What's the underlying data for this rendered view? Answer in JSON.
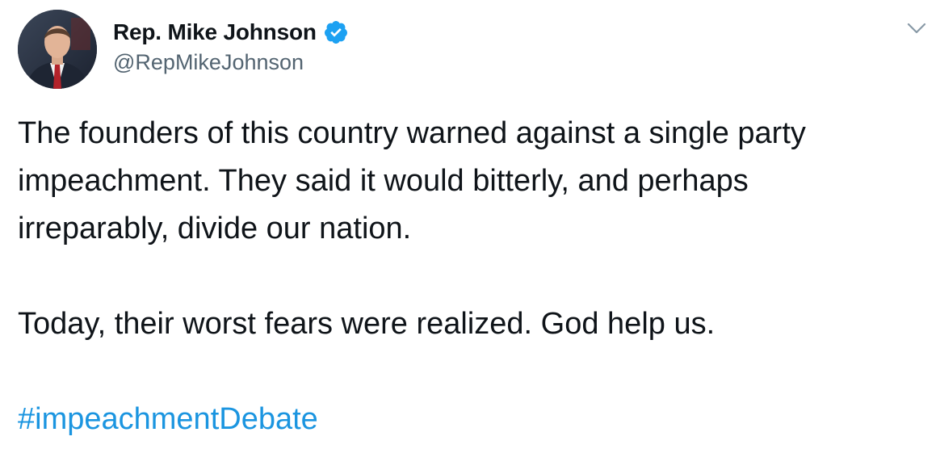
{
  "author": {
    "display_name": "Rep. Mike Johnson",
    "handle": "@RepMikeJohnson",
    "verified": true,
    "avatar_icon": "profile-photo"
  },
  "tweet": {
    "paragraph_1": "The founders of this country warned against a single party impeachment. They said it would bitterly, and perhaps irreparably, divide our nation.",
    "paragraph_2": "Today, their worst fears were realized. God help us.",
    "hashtag": "#impeachmentDebate"
  },
  "icons": {
    "verified": "verified-badge-icon",
    "more": "chevron-down-icon"
  },
  "colors": {
    "link": "#1b95e0",
    "verified": "#1da1f2",
    "text": "#0f1419",
    "secondary": "#536471"
  }
}
